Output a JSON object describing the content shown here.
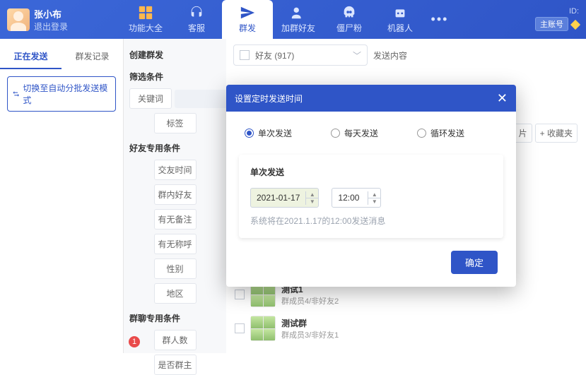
{
  "user": {
    "name": "张小布",
    "logout": "退出登录"
  },
  "nav": {
    "items": [
      {
        "label": "功能大全"
      },
      {
        "label": "客服"
      },
      {
        "label": "群发"
      },
      {
        "label": "加群好友"
      },
      {
        "label": "僵尸粉"
      },
      {
        "label": "机器人"
      }
    ]
  },
  "id_box": {
    "label": "ID:",
    "badge": "主账号"
  },
  "left": {
    "tabs": [
      "正在发送",
      "群发记录"
    ],
    "switch": "切换至自动分批发送模式"
  },
  "mid": {
    "create": "创建群发",
    "filter": "筛选条件",
    "keyword": "关键词",
    "tag": "标签",
    "sec_friend": "好友专用条件",
    "friend_conds": [
      "交友时间",
      "群内好友",
      "有无备注",
      "有无称呼",
      "性别",
      "地区"
    ],
    "sec_group": "群聊专用条件",
    "group_conds": [
      "群人数",
      "是否群主"
    ]
  },
  "right": {
    "friend_sel": "好友  (917)",
    "send_content": "发送内容",
    "chips": [
      "片",
      "+ 收藏夹"
    ],
    "groups": [
      {
        "name": "测试1",
        "meta": "群成员4/非好友2"
      },
      {
        "name": "测试群",
        "meta": "群成员3/非好友1"
      }
    ],
    "badge": "1"
  },
  "modal": {
    "title": "设置定时发送时间",
    "radios": [
      "单次发送",
      "每天发送",
      "循环发送"
    ],
    "card_title": "单次发送",
    "date": "2021-01-17",
    "time": "12:00",
    "hint": "系统将在2021.1.17的12:00发送消息",
    "ok": "确定"
  }
}
